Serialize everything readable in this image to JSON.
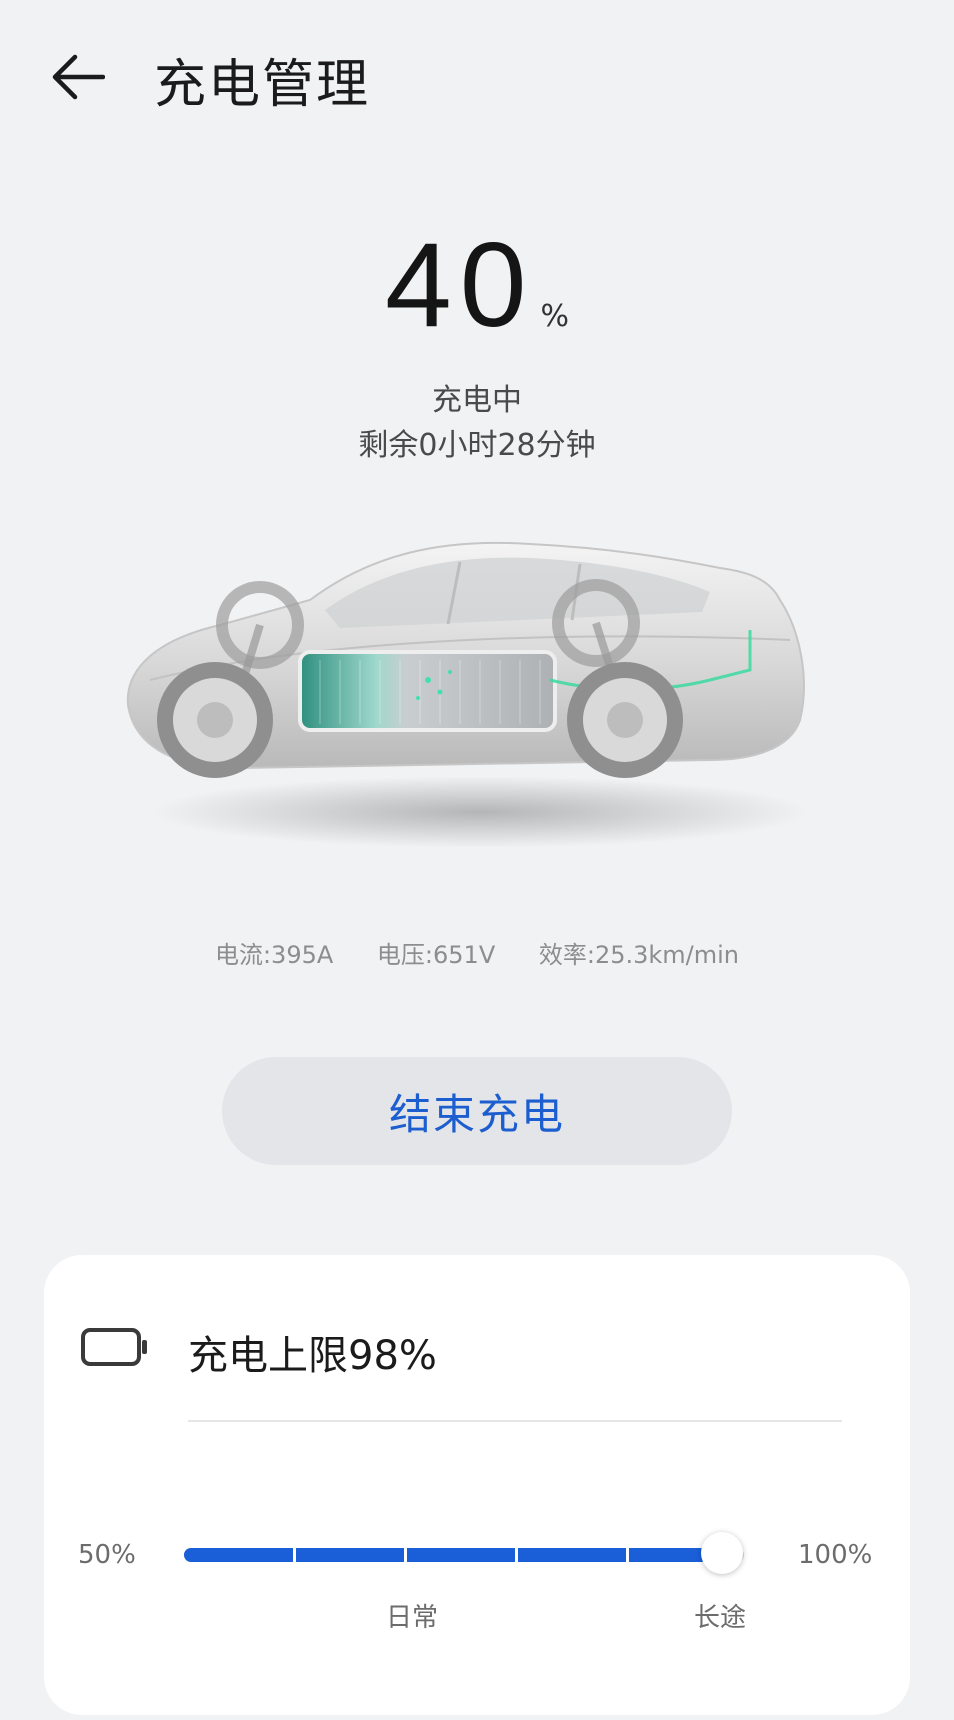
{
  "header": {
    "title": "充电管理",
    "back_icon": "arrow-left-icon"
  },
  "status": {
    "percent": "40",
    "unit": "%",
    "state": "充电中",
    "remaining": "剩余0小时28分钟"
  },
  "metrics": {
    "current": "电流:395A",
    "voltage": "电压:651V",
    "efficiency": "效率:25.3km/min"
  },
  "actions": {
    "end_charging": "结束充电"
  },
  "limit": {
    "icon": "battery-icon",
    "title": "充电上限98%",
    "min_label": "50%",
    "max_label": "100%",
    "value_percent": 98,
    "mark_daily": "日常",
    "mark_long_trip": "长途"
  },
  "colors": {
    "accent": "#1a5fd8",
    "button_text": "#1c5ecf",
    "background": "#f1f2f4",
    "battery_glow": "#1fc58a"
  }
}
